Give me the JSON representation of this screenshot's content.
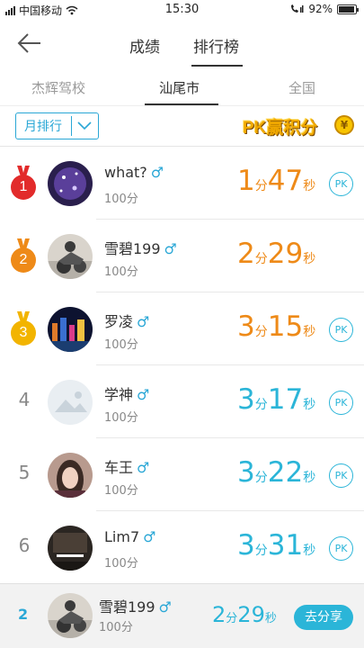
{
  "status_bar": {
    "carrier": "中国移动",
    "time": "15:30",
    "battery": "92%",
    "battery_level": 0.92
  },
  "header": {
    "back_icon": "arrow-left-icon",
    "tabs": [
      {
        "label": "成绩",
        "active": false
      },
      {
        "label": "排行榜",
        "active": true
      }
    ]
  },
  "sub_tabs": [
    {
      "label": "杰辉驾校",
      "active": false
    },
    {
      "label": "汕尾市",
      "active": true
    },
    {
      "label": "全国",
      "active": false
    }
  ],
  "filter": {
    "period_label": "月排行",
    "dropdown_icon": "chevron-down-icon"
  },
  "pk_banner": {
    "text": "PK赢积分",
    "coin_symbol": "¥"
  },
  "colors": {
    "accent_blue": "#2bb5d8",
    "orange": "#ee8a18",
    "gold_medal": "#f2a800",
    "silver_medal": "#ee8a18",
    "first_medal": "#e22b2b"
  },
  "ranking": [
    {
      "rank": "1",
      "medal": "red",
      "name": "what?",
      "gender": "♂",
      "points": "100分",
      "minutes": "1",
      "min_unit": "分",
      "seconds": "47",
      "sec_unit": "秒",
      "time_color": "orange",
      "pk": "PK",
      "has_pk": true,
      "avatar_theme": "purple"
    },
    {
      "rank": "2",
      "medal": "orange",
      "name": "雪碧199",
      "gender": "♂",
      "points": "100分",
      "minutes": "2",
      "min_unit": "分",
      "seconds": "29",
      "sec_unit": "秒",
      "time_color": "orange",
      "pk": "",
      "has_pk": false,
      "avatar_theme": "moto"
    },
    {
      "rank": "3",
      "medal": "yellow",
      "name": "罗凌",
      "gender": "♂",
      "points": "100分",
      "minutes": "3",
      "min_unit": "分",
      "seconds": "15",
      "sec_unit": "秒",
      "time_color": "orange",
      "pk": "PK",
      "has_pk": true,
      "avatar_theme": "city"
    },
    {
      "rank": "4",
      "medal": "",
      "name": "学神",
      "gender": "♂",
      "points": "100分",
      "minutes": "3",
      "min_unit": "分",
      "seconds": "17",
      "sec_unit": "秒",
      "time_color": "blue",
      "pk": "PK",
      "has_pk": true,
      "avatar_theme": "placeholder"
    },
    {
      "rank": "5",
      "medal": "",
      "name": "车王",
      "gender": "♂",
      "points": "100分",
      "minutes": "3",
      "min_unit": "分",
      "seconds": "22",
      "sec_unit": "秒",
      "time_color": "blue",
      "pk": "PK",
      "has_pk": true,
      "avatar_theme": "girl"
    },
    {
      "rank": "6",
      "medal": "",
      "name": "Lim7",
      "gender": "♂",
      "points": "100分",
      "minutes": "3",
      "min_unit": "分",
      "seconds": "31",
      "sec_unit": "秒",
      "time_color": "blue",
      "pk": "PK",
      "has_pk": true,
      "avatar_theme": "dark"
    }
  ],
  "my_rank": {
    "rank": "2",
    "name": "雪碧199",
    "gender": "♂",
    "points": "100分",
    "minutes": "2",
    "min_unit": "分",
    "seconds": "29",
    "sec_unit": "秒",
    "share_label": "去分享"
  }
}
